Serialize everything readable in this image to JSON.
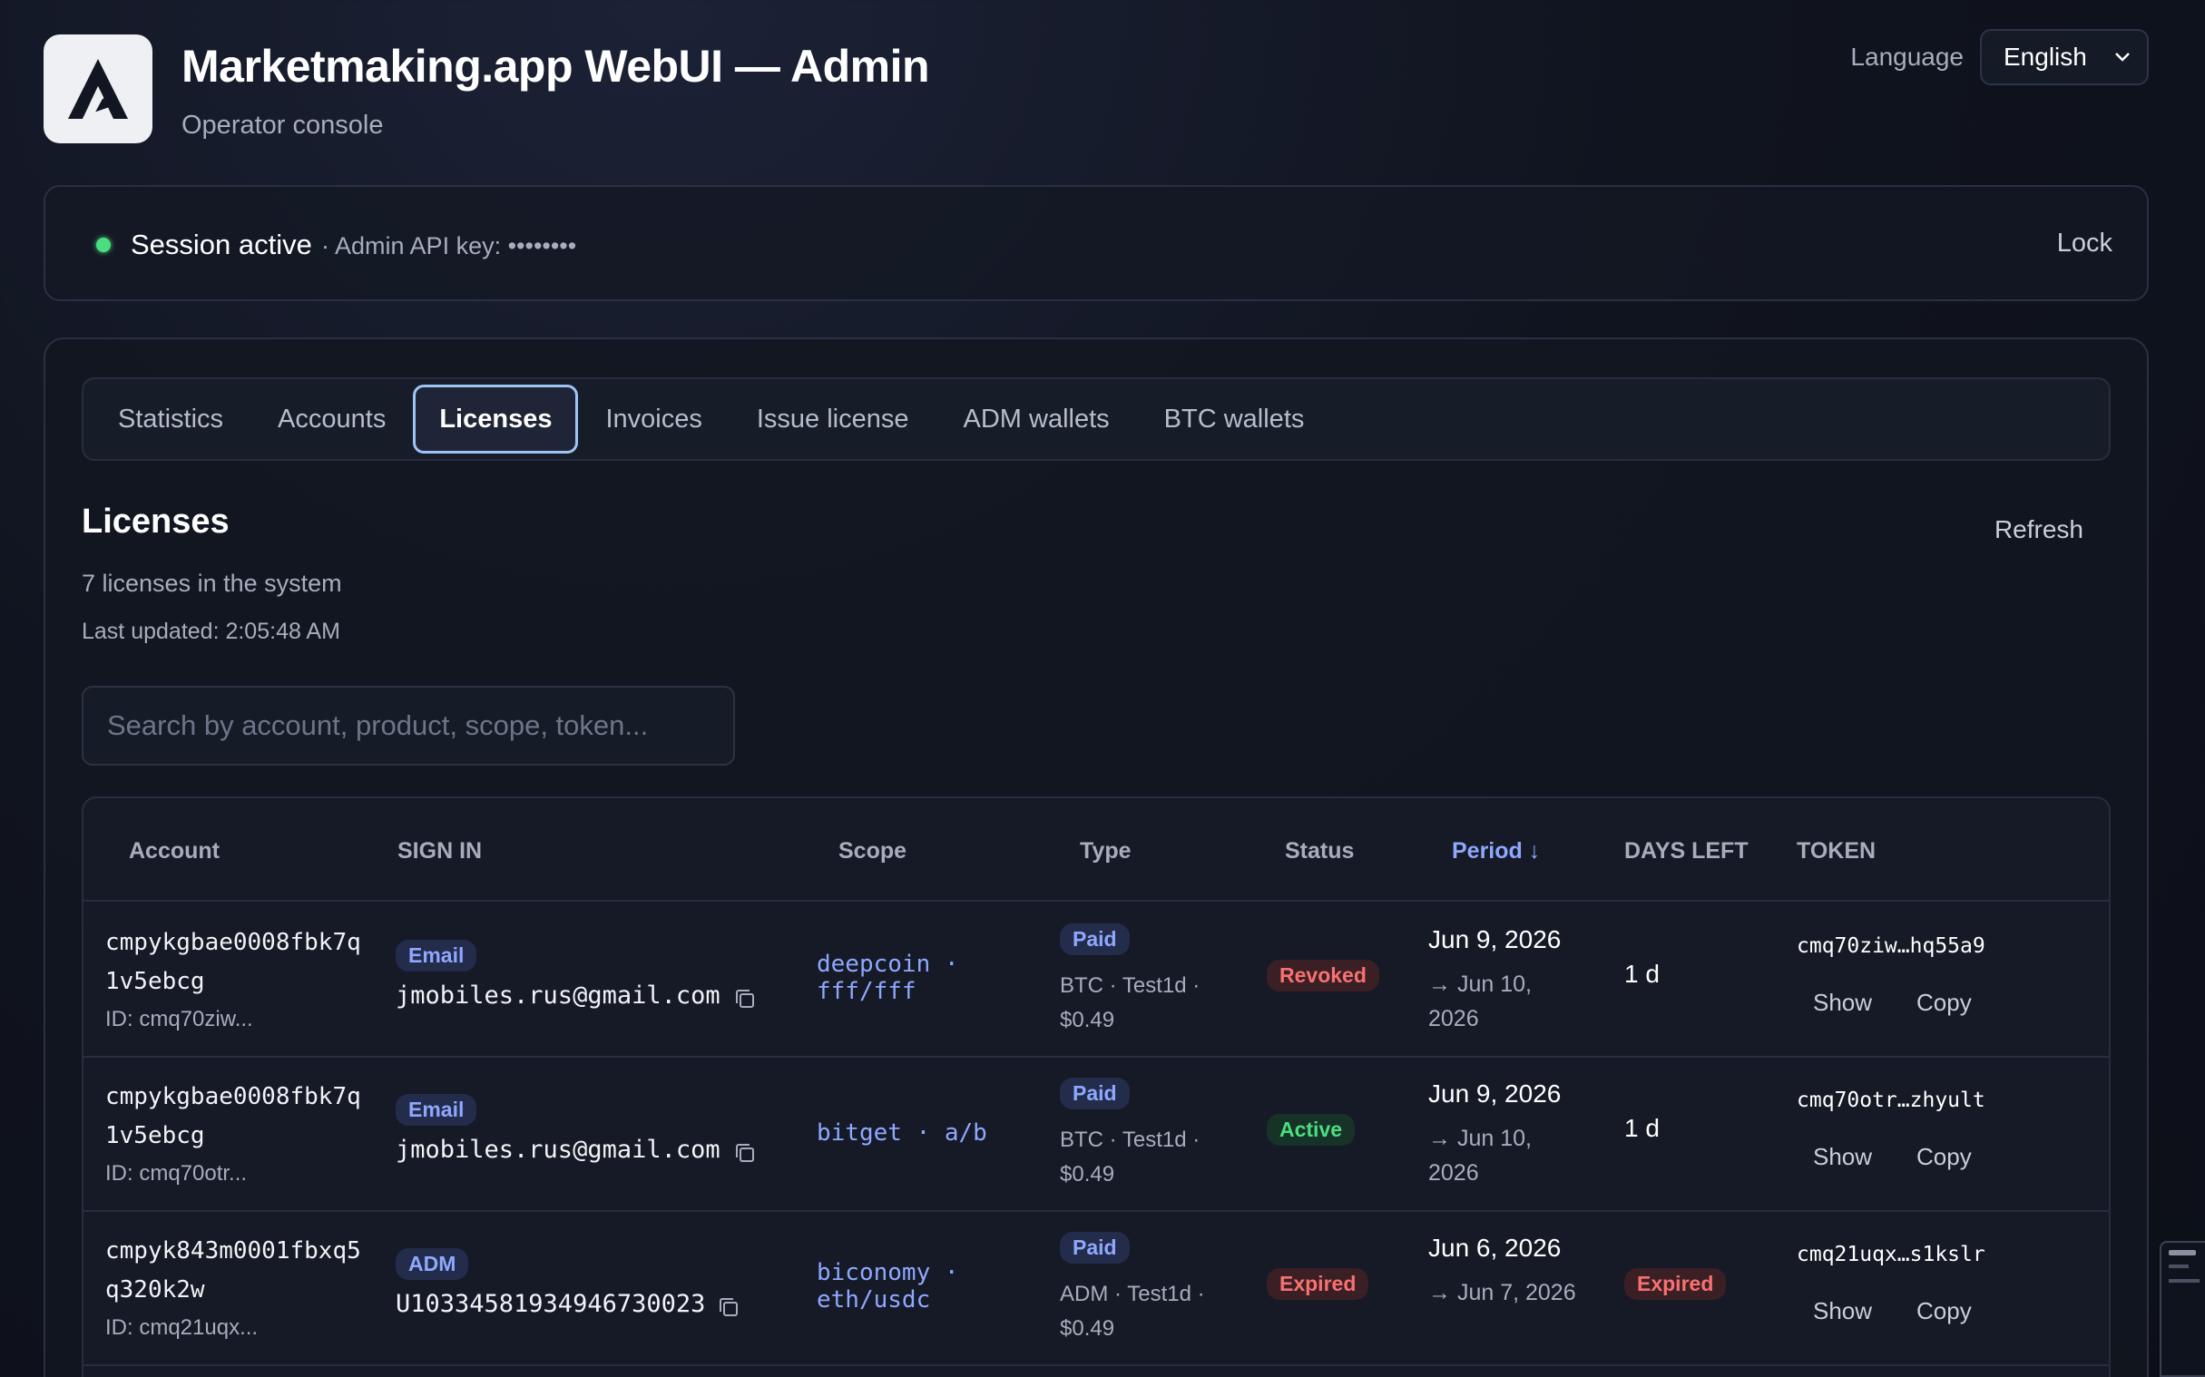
{
  "header": {
    "title": "Marketmaking.app WebUI — Admin",
    "subtitle": "Operator console",
    "logo_icon": "brand-a-logo"
  },
  "language": {
    "label": "Language",
    "selected": "English"
  },
  "session": {
    "status": "Session active",
    "api_key": "· Admin API key: ••••••••",
    "lock_label": "Lock",
    "status_color": "#4ade80"
  },
  "tabs": [
    {
      "label": "Statistics",
      "active": false
    },
    {
      "label": "Accounts",
      "active": false
    },
    {
      "label": "Licenses",
      "active": true
    },
    {
      "label": "Invoices",
      "active": false
    },
    {
      "label": "Issue license",
      "active": false
    },
    {
      "label": "ADM wallets",
      "active": false
    },
    {
      "label": "BTC wallets",
      "active": false
    }
  ],
  "licenses": {
    "title": "Licenses",
    "count_text": "7 licenses in the system",
    "last_updated": "Last updated: 2:05:48 AM",
    "refresh_label": "Refresh",
    "search_placeholder": "Search by account, product, scope, token..."
  },
  "table": {
    "columns": [
      "Account",
      "SIGN IN",
      "Scope",
      "Type",
      "Status",
      "Period ↓",
      "DAYS LEFT",
      "TOKEN"
    ],
    "show_label": "Show",
    "copy_label": "Copy",
    "rows": [
      {
        "account": "cmpykgbae0008fbk7q1v5ebcg",
        "account_id": "ID: cmq70ziw...",
        "signin_method": "Email",
        "signin_value": "jmobiles.rus@gmail.com",
        "scope": "deepcoin · fff/fff",
        "type": "Paid",
        "type_detail": "BTC · Test1d · $0.49",
        "status": "Revoked",
        "period_start": "Jun 9, 2026",
        "period_end": "→ Jun 10, 2026",
        "days_left": "1 d",
        "token": "cmq70ziw…hq55a9"
      },
      {
        "account": "cmpykgbae0008fbk7q1v5ebcg",
        "account_id": "ID: cmq70otr...",
        "signin_method": "Email",
        "signin_value": "jmobiles.rus@gmail.com",
        "scope": "bitget · a/b",
        "type": "Paid",
        "type_detail": "BTC · Test1d · $0.49",
        "status": "Active",
        "period_start": "Jun 9, 2026",
        "period_end": "→ Jun 10, 2026",
        "days_left": "1 d",
        "token": "cmq70otr…zhyult"
      },
      {
        "account": "cmpyk843m0001fbxq5q320k2w",
        "account_id": "ID: cmq21uqx...",
        "signin_method": "ADM",
        "signin_value": "U10334581934946730023",
        "scope": "biconomy · eth/usdc",
        "type": "Paid",
        "type_detail": "ADM · Test1d · $0.49",
        "status": "Expired",
        "period_start": "Jun 6, 2026",
        "period_end": "→ Jun 7, 2026",
        "days_left": "Expired",
        "token": "cmq21uqx…s1kslr"
      }
    ]
  }
}
